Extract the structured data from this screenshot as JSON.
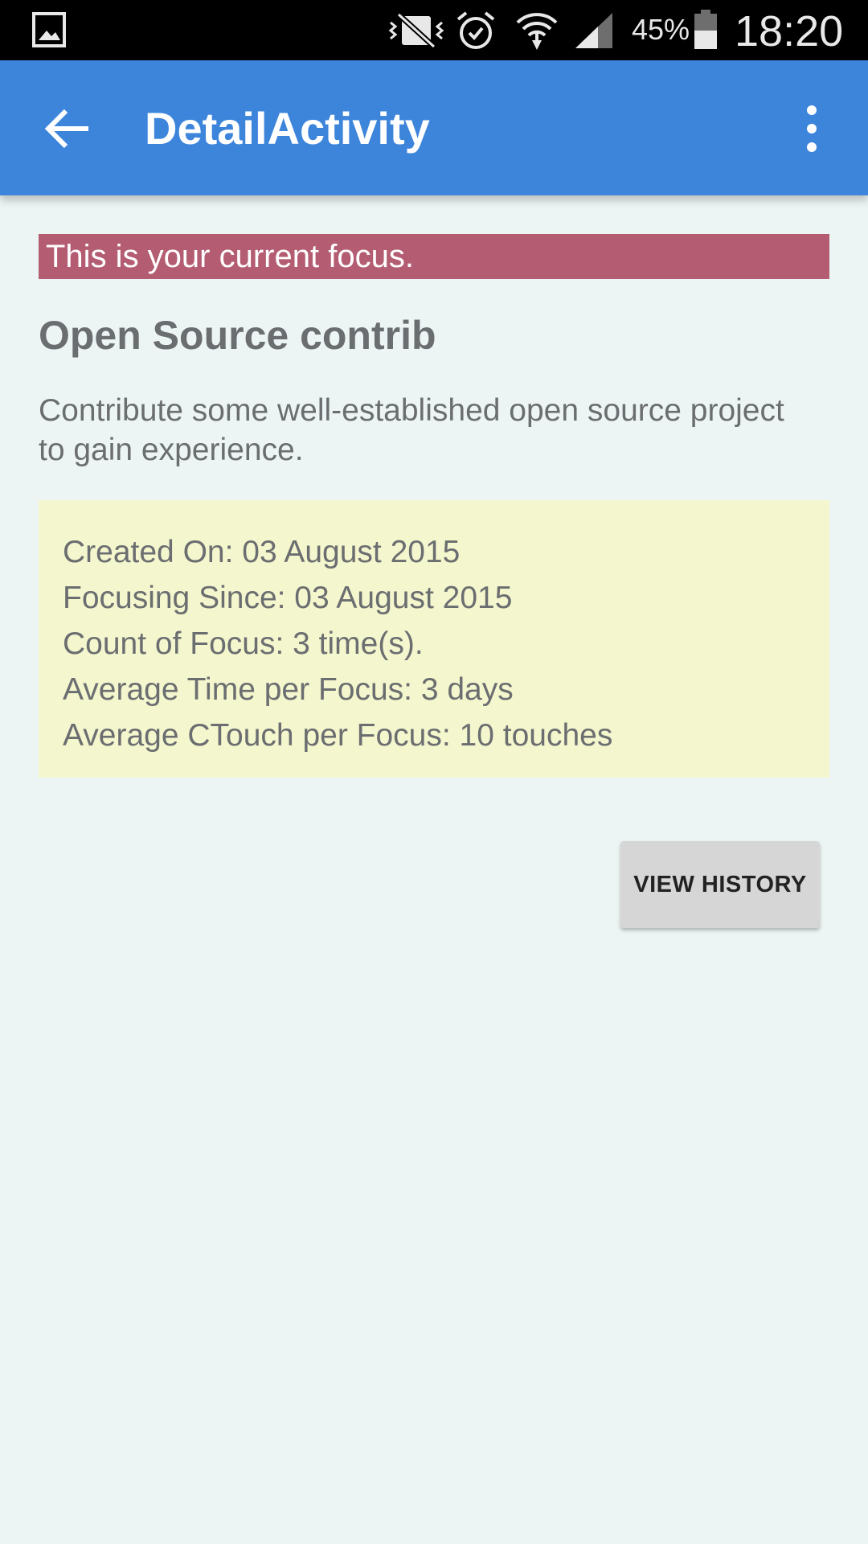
{
  "status_bar": {
    "icons": [
      "gallery-icon",
      "vibrate-off-icon",
      "alarm-icon",
      "wifi-icon",
      "cell-signal-icon",
      "battery-icon"
    ],
    "battery_percent": "45%",
    "time": "18:20"
  },
  "app_bar": {
    "title": "DetailActivity",
    "back_icon": "arrow-left-icon",
    "menu_icon": "more-vert-icon"
  },
  "content": {
    "focus_banner": "This is your current focus.",
    "goal_title": "Open Source contrib",
    "goal_description": "Contribute some well-established open source project to gain experience.",
    "stats": [
      "Created On: 03 August 2015",
      "Focusing Since: 03 August 2015",
      "Count of Focus: 3 time(s).",
      "Average Time per Focus: 3 days",
      "Average CTouch per Focus: 10 touches"
    ],
    "view_history_label": "VIEW HISTORY"
  },
  "colors": {
    "app_bar": "#3D85DB",
    "focus_banner": "#B45D72",
    "stats_card": "#F4F6CD",
    "background": "#EDF5F4"
  }
}
